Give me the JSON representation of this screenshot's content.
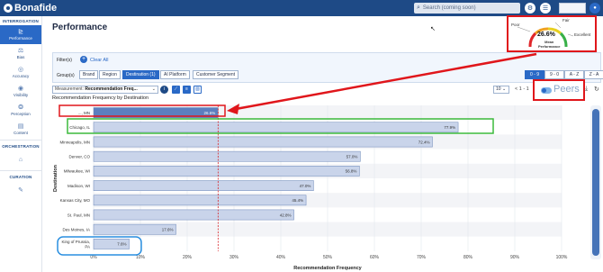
{
  "app": {
    "brand": "Bonafide"
  },
  "topbar": {
    "search_placeholder": "Search (coming soon)",
    "search_icon": "search-icon",
    "icons": [
      "settings-icon",
      "user-menu-icon",
      "account-icon"
    ]
  },
  "sidebar": {
    "section_1": "INTERROGATION",
    "items_1": [
      {
        "label": "Performance",
        "icon": "chart-icon",
        "glyph": "⊵",
        "active": true
      },
      {
        "label": "Bias",
        "icon": "scale-icon",
        "glyph": "⚖"
      },
      {
        "label": "Accuracy",
        "icon": "target-icon",
        "glyph": "◎"
      },
      {
        "label": "Visibility",
        "icon": "eye-icon",
        "glyph": "◉"
      },
      {
        "label": "Perception",
        "icon": "brain-icon",
        "glyph": "❂"
      },
      {
        "label": "Content",
        "icon": "document-icon",
        "glyph": "▤"
      }
    ],
    "section_2": "ORCHESTRATION",
    "items_2": [
      {
        "label": "",
        "icon": "orchestration-icon",
        "glyph": "⌂"
      }
    ],
    "section_3": "CURATION",
    "items_3": [
      {
        "label": "",
        "icon": "curation-icon",
        "glyph": "✎"
      }
    ]
  },
  "page": {
    "title": "Performance"
  },
  "gauge": {
    "value": "26.6%",
    "label_line1": "Mean",
    "label_line2": "Performance",
    "poor": "Poor",
    "fair": "Fair",
    "excellent": "Excellent",
    "fraction": 0.266
  },
  "filters": {
    "label": "Filter(s)",
    "clear_all": "Clear All",
    "group_label": "Group(s)",
    "groups": [
      "Brand",
      "Region",
      "Destination (1)",
      "AI Platform",
      "Customer Segment"
    ],
    "active_group": "Destination (1)",
    "sort_options": [
      "0 - 9",
      "9 - 0",
      "A - Z",
      "Z - A"
    ],
    "active_sort": "0 - 9"
  },
  "controls": {
    "measurement_label": "Measurement:",
    "measurement_value": "Recommendation Freq...",
    "info_icon": "info-icon",
    "view_icons": [
      "line-chart-icon",
      "bar-chart-icon",
      "image-icon"
    ],
    "page_size": "10",
    "pager_text": "< 1 - 1",
    "peers_label": "Peers",
    "peers_on": true,
    "download_icon": "download-icon",
    "refresh_icon": "refresh-icon"
  },
  "chart_title": "Recommendation Frequency by Destination",
  "chart_data": {
    "type": "bar",
    "orientation": "horizontal",
    "title": "Recommendation Frequency by Destination",
    "xlabel": "Recommendation Frequency",
    "ylabel": "Destination",
    "categories": [
      "..., MN",
      "Chicago, IL",
      "Minneapolis, MN",
      "Denver, CO",
      "Milwaukee, WI",
      "Madison, WI",
      "Kansas City, MO",
      "St. Paul, MN",
      "Des Moines, IA",
      "King of Prussia, PA"
    ],
    "category_lines": [
      [
        "..., MN"
      ],
      [
        "Chicago, IL"
      ],
      [
        "Minneapolis, MN"
      ],
      [
        "Denver, CO"
      ],
      [
        "Milwaukee, WI"
      ],
      [
        "Madison, WI"
      ],
      [
        "Kansas City, MO"
      ],
      [
        "St. Paul, MN"
      ],
      [
        "Des Moines, IA"
      ],
      [
        "King of Prussia,",
        "PA"
      ]
    ],
    "values": [
      26.6,
      77.9,
      72.4,
      57.0,
      56.8,
      47.0,
      45.4,
      42.8,
      17.6,
      7.6
    ],
    "labels": [
      "26.6%",
      "77.9%",
      "72.4%",
      "57.0%",
      "56.8%",
      "47.0%",
      "45.4%",
      "42.8%",
      "17.6%",
      "7.6%"
    ],
    "highlight_index": 0,
    "reference_line": 26.6,
    "xlim": [
      0,
      100
    ],
    "xticks": [
      "0%",
      "10%",
      "20%",
      "30%",
      "40%",
      "50%",
      "60%",
      "70%",
      "80%",
      "90%",
      "100%"
    ],
    "grid": true,
    "colors": {
      "bar": "#c9d4ea",
      "bar_border": "#6b86b8",
      "highlight": "#5c7fbf",
      "reference": "#d9262a"
    }
  },
  "annotations": {
    "gauge_box_color": "#e0161b",
    "arrow_color": "#e0161b",
    "chicago_box_color": "#3cba3c",
    "kop_box_color": "#2a8fe0",
    "peers_box_color": "#e0161b"
  }
}
